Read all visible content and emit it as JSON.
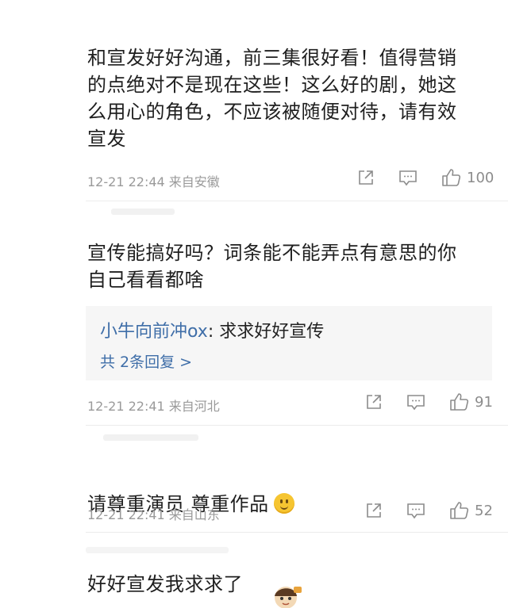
{
  "comments": [
    {
      "text": "和宣发好好沟通，前三集很好看！值得营销\n的点绝对不是现在这些！这么好的剧，她这\n么用心的角色，不应该被随便对待，请有效\n宣发",
      "time": "12-21 22:44",
      "location": "来自安徽",
      "likes": "100"
    },
    {
      "text": "宣传能搞好吗？词条能不能弄点有意思的你\n自己看看都啥",
      "reply": {
        "name": "小牛向前冲ox",
        "text": "求求好好宣传",
        "more": "共 2条回复 >"
      },
      "time": "12-21 22:41",
      "location": "来自河北",
      "likes": "91"
    },
    {
      "text": "请尊重演员 尊重作品",
      "time": "12-21 22:41",
      "location": "来自山东",
      "likes": "52"
    },
    {
      "text": "好好宣发我求求了"
    }
  ],
  "icons": {
    "share": "share-icon",
    "comment": "comment-icon",
    "like": "thumbs-up-icon",
    "emoji": "smile-emoji-icon"
  },
  "colors": {
    "link": "#3f6ea8",
    "meta": "#9a9a9a",
    "reply_bg": "#f6f6f6"
  }
}
